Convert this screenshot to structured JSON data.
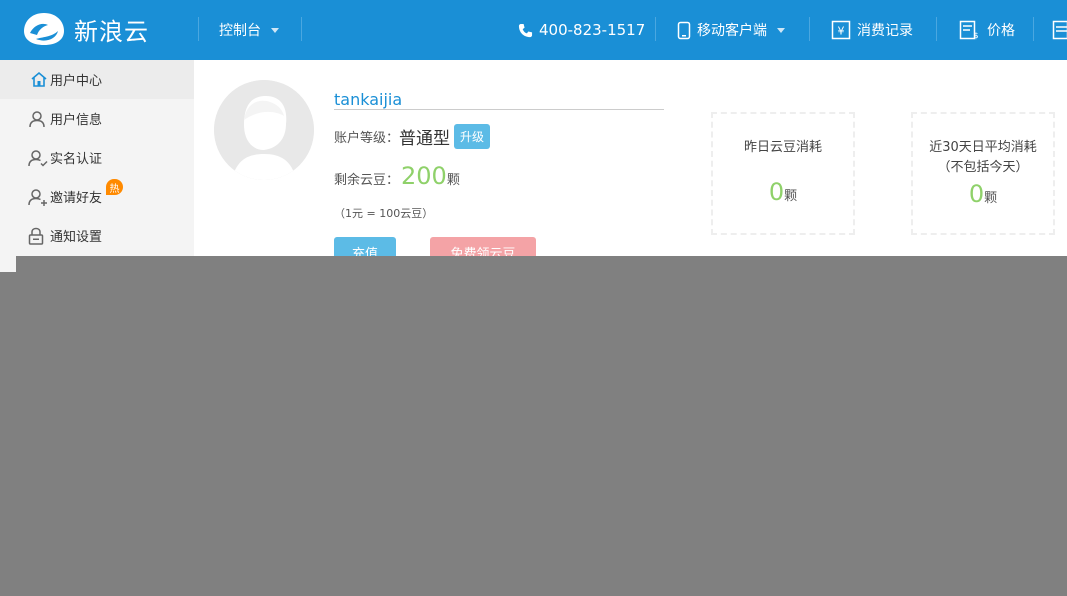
{
  "header": {
    "logo_text": "新浪云",
    "console_label": "控制台",
    "phone": "400-823-1517",
    "mobile_label": "移动客户端",
    "billing_label": "消费记录",
    "price_label": "价格"
  },
  "sidebar": {
    "items": [
      {
        "label": "用户中心",
        "icon": "home-icon"
      },
      {
        "label": "用户信息",
        "icon": "user-icon"
      },
      {
        "label": "实名认证",
        "icon": "user-check-icon"
      },
      {
        "label": "邀请好友",
        "icon": "user-add-icon",
        "badge": "热"
      },
      {
        "label": "通知设置",
        "icon": "lock-icon"
      }
    ]
  },
  "profile": {
    "username": "tankaijia",
    "level_label": "账户等级：",
    "level_value": "普通型",
    "upgrade_label": "升级",
    "beans_label": "剩余云豆：",
    "beans_value": "200",
    "beans_unit": "颗",
    "rate_text": "（1元 = 100云豆）",
    "charge_label": "充值",
    "free_label": "免费领云豆"
  },
  "stats": [
    {
      "title": "昨日云豆消耗",
      "subtitle": "",
      "value": "0",
      "unit": "颗"
    },
    {
      "title": "近30天日平均消耗",
      "subtitle": "（不包括今天）",
      "value": "0",
      "unit": "颗"
    }
  ],
  "colors": {
    "header_bg": "#1a8fd6",
    "accent_green": "#8fd16a",
    "button_blue": "#5cbbe6",
    "button_pink": "#f4a3a6",
    "overlay": "#808080"
  }
}
